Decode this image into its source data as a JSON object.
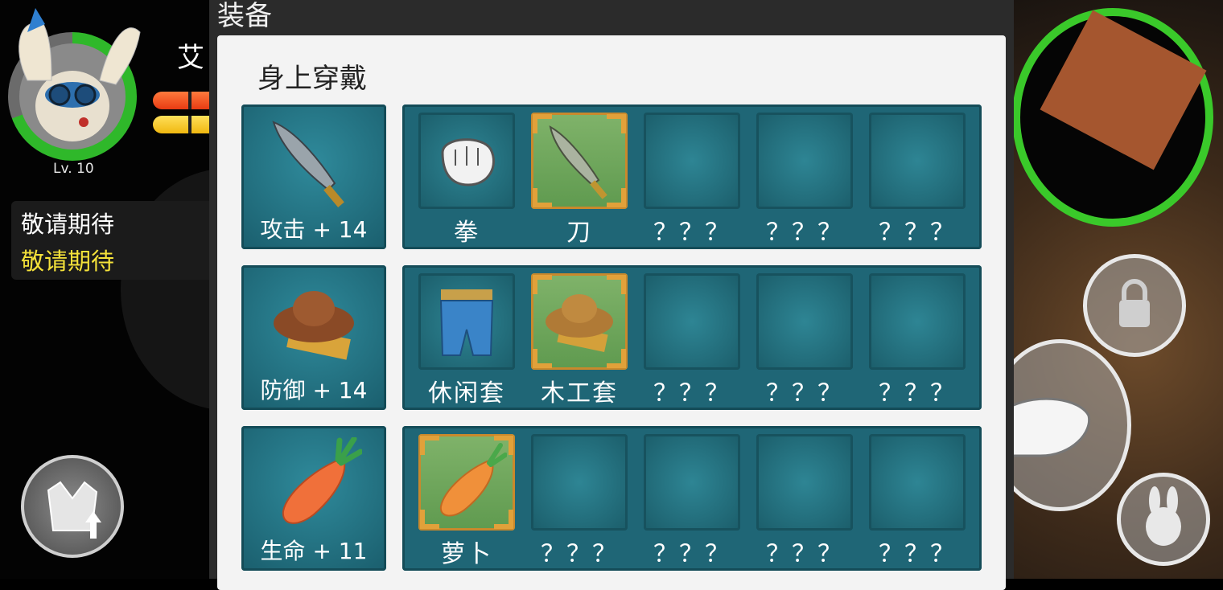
{
  "player": {
    "level_label": "Lv. 10",
    "name_partial": "艾"
  },
  "quests": [
    "敬请期待",
    "敬请期待"
  ],
  "panel": {
    "title": "装备",
    "section_title": "身上穿戴"
  },
  "equipment_rows": [
    {
      "stat_label": "攻击 + 14",
      "stat_icon": "blade-icon",
      "slots": [
        {
          "label": "拳",
          "icon": "fist-icon",
          "selected": false
        },
        {
          "label": "刀",
          "icon": "blade-icon",
          "selected": true
        },
        {
          "label": "？？？",
          "icon": "",
          "selected": false
        },
        {
          "label": "？？？",
          "icon": "",
          "selected": false
        },
        {
          "label": "？？？",
          "icon": "",
          "selected": false
        }
      ]
    },
    {
      "stat_label": "防御 + 14",
      "stat_icon": "straw-hat-icon",
      "slots": [
        {
          "label": "休闲套",
          "icon": "overalls-icon",
          "selected": false
        },
        {
          "label": "木工套",
          "icon": "straw-hat-icon",
          "selected": true
        },
        {
          "label": "？？？",
          "icon": "",
          "selected": false
        },
        {
          "label": "？？？",
          "icon": "",
          "selected": false
        },
        {
          "label": "？？？",
          "icon": "",
          "selected": false
        }
      ]
    },
    {
      "stat_label": "生命 + 11",
      "stat_icon": "carrot-icon",
      "slots": [
        {
          "label": "萝卜",
          "icon": "carrot-icon",
          "selected": true
        },
        {
          "label": "？？？",
          "icon": "",
          "selected": false
        },
        {
          "label": "？？？",
          "icon": "",
          "selected": false
        },
        {
          "label": "？？？",
          "icon": "",
          "selected": false
        },
        {
          "label": "？？？",
          "icon": "",
          "selected": false
        }
      ]
    }
  ]
}
